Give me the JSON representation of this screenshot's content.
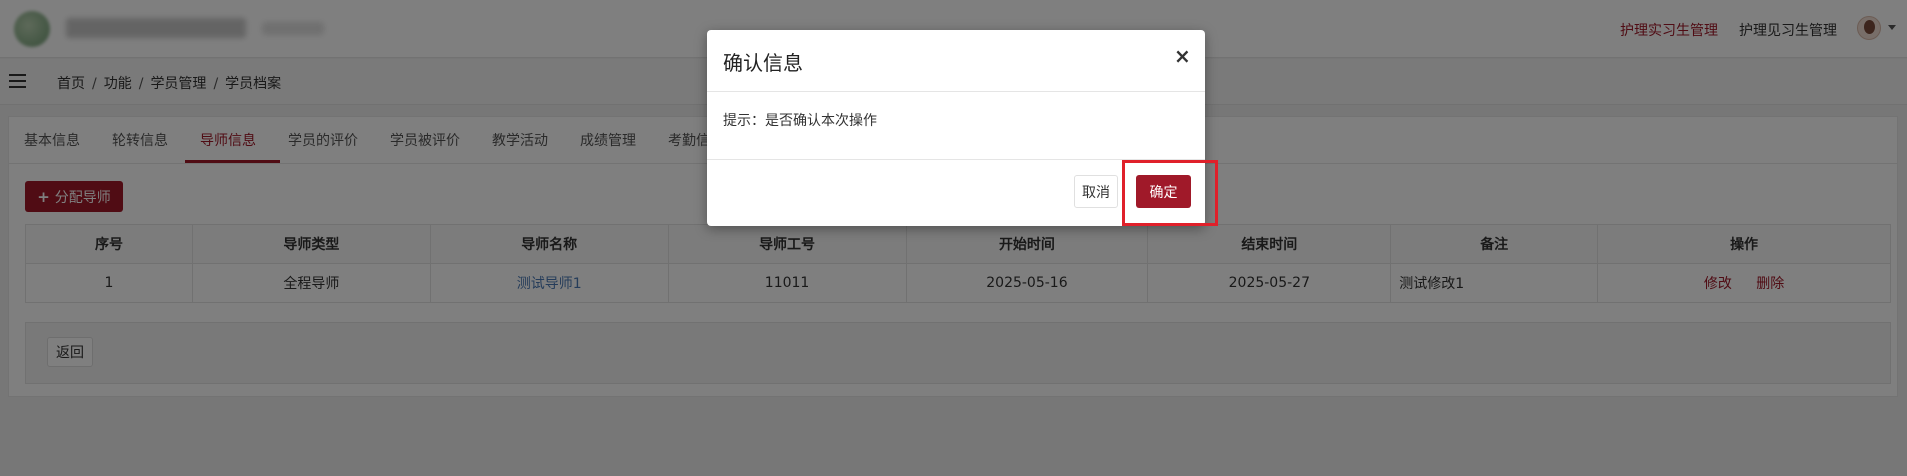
{
  "colors": {
    "accent": "#a01929",
    "link_blue": "#4a79b5",
    "highlight": "#e0202a"
  },
  "header": {
    "links": [
      "护理实习生管理",
      "护理见习生管理"
    ],
    "active_link": "护理实习生管理"
  },
  "breadcrumb": [
    "首页",
    "功能",
    "学员管理",
    "学员档案"
  ],
  "tabs": [
    "基本信息",
    "轮转信息",
    "导师信息",
    "学员的评价",
    "学员被评价",
    "教学活动",
    "成绩管理",
    "考勤信"
  ],
  "active_tab": "导师信息",
  "toolbar": {
    "assign_label": "分配导师"
  },
  "table": {
    "headers": [
      "序号",
      "导师类型",
      "导师名称",
      "导师工号",
      "开始时间",
      "结束时间",
      "备注",
      "操作"
    ],
    "rows": [
      {
        "index": "1",
        "type": "全程导师",
        "name": "测试导师1",
        "id": "11011",
        "start": "2025-05-16",
        "end": "2025-05-27",
        "note": "测试修改1",
        "edit_label": "修改",
        "delete_label": "删除"
      }
    ]
  },
  "footer": {
    "back_label": "返回"
  },
  "modal": {
    "title": "确认信息",
    "close_glyph": "×",
    "message": "提示：是否确认本次操作",
    "cancel_label": "取消",
    "ok_label": "确定"
  }
}
